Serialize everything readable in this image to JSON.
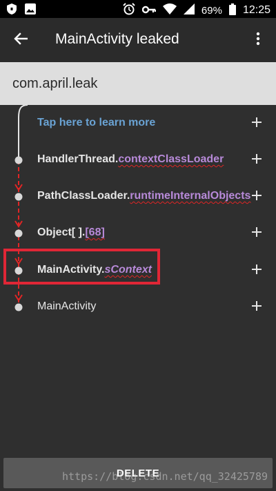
{
  "status_bar": {
    "battery": "69%",
    "time": "12:25",
    "icons": [
      "shield-icon",
      "image-icon",
      "alarm-icon",
      "key-icon",
      "wifi-icon",
      "signal-icon",
      "battery-icon"
    ]
  },
  "app_bar": {
    "title": "MainActivity leaked",
    "back_icon": "arrow-back-icon",
    "menu_icon": "more-vert-icon"
  },
  "package": {
    "name": "com.april.leak"
  },
  "trace": {
    "learn_more": "Tap here to learn more",
    "rows": [
      {
        "class": "HandlerThread.",
        "field": "contextClassLoader"
      },
      {
        "class": "PathClassLoader.",
        "field": "runtimeInternalObjects"
      },
      {
        "class": "Object[ ].",
        "field": "[68]"
      },
      {
        "class": "MainActivity.",
        "field": "sContext"
      },
      {
        "class": "MainActivity",
        "field": ""
      }
    ],
    "expand_icon": "plus-icon"
  },
  "colors": {
    "accent_link": "#6aa3d4",
    "field": "#b88ad9",
    "leak_line": "#e02525",
    "highlight": "#e02636"
  },
  "footer": {
    "delete_label": "DELETE",
    "watermark": "https://blog.csdn.net/qq_32425789"
  }
}
